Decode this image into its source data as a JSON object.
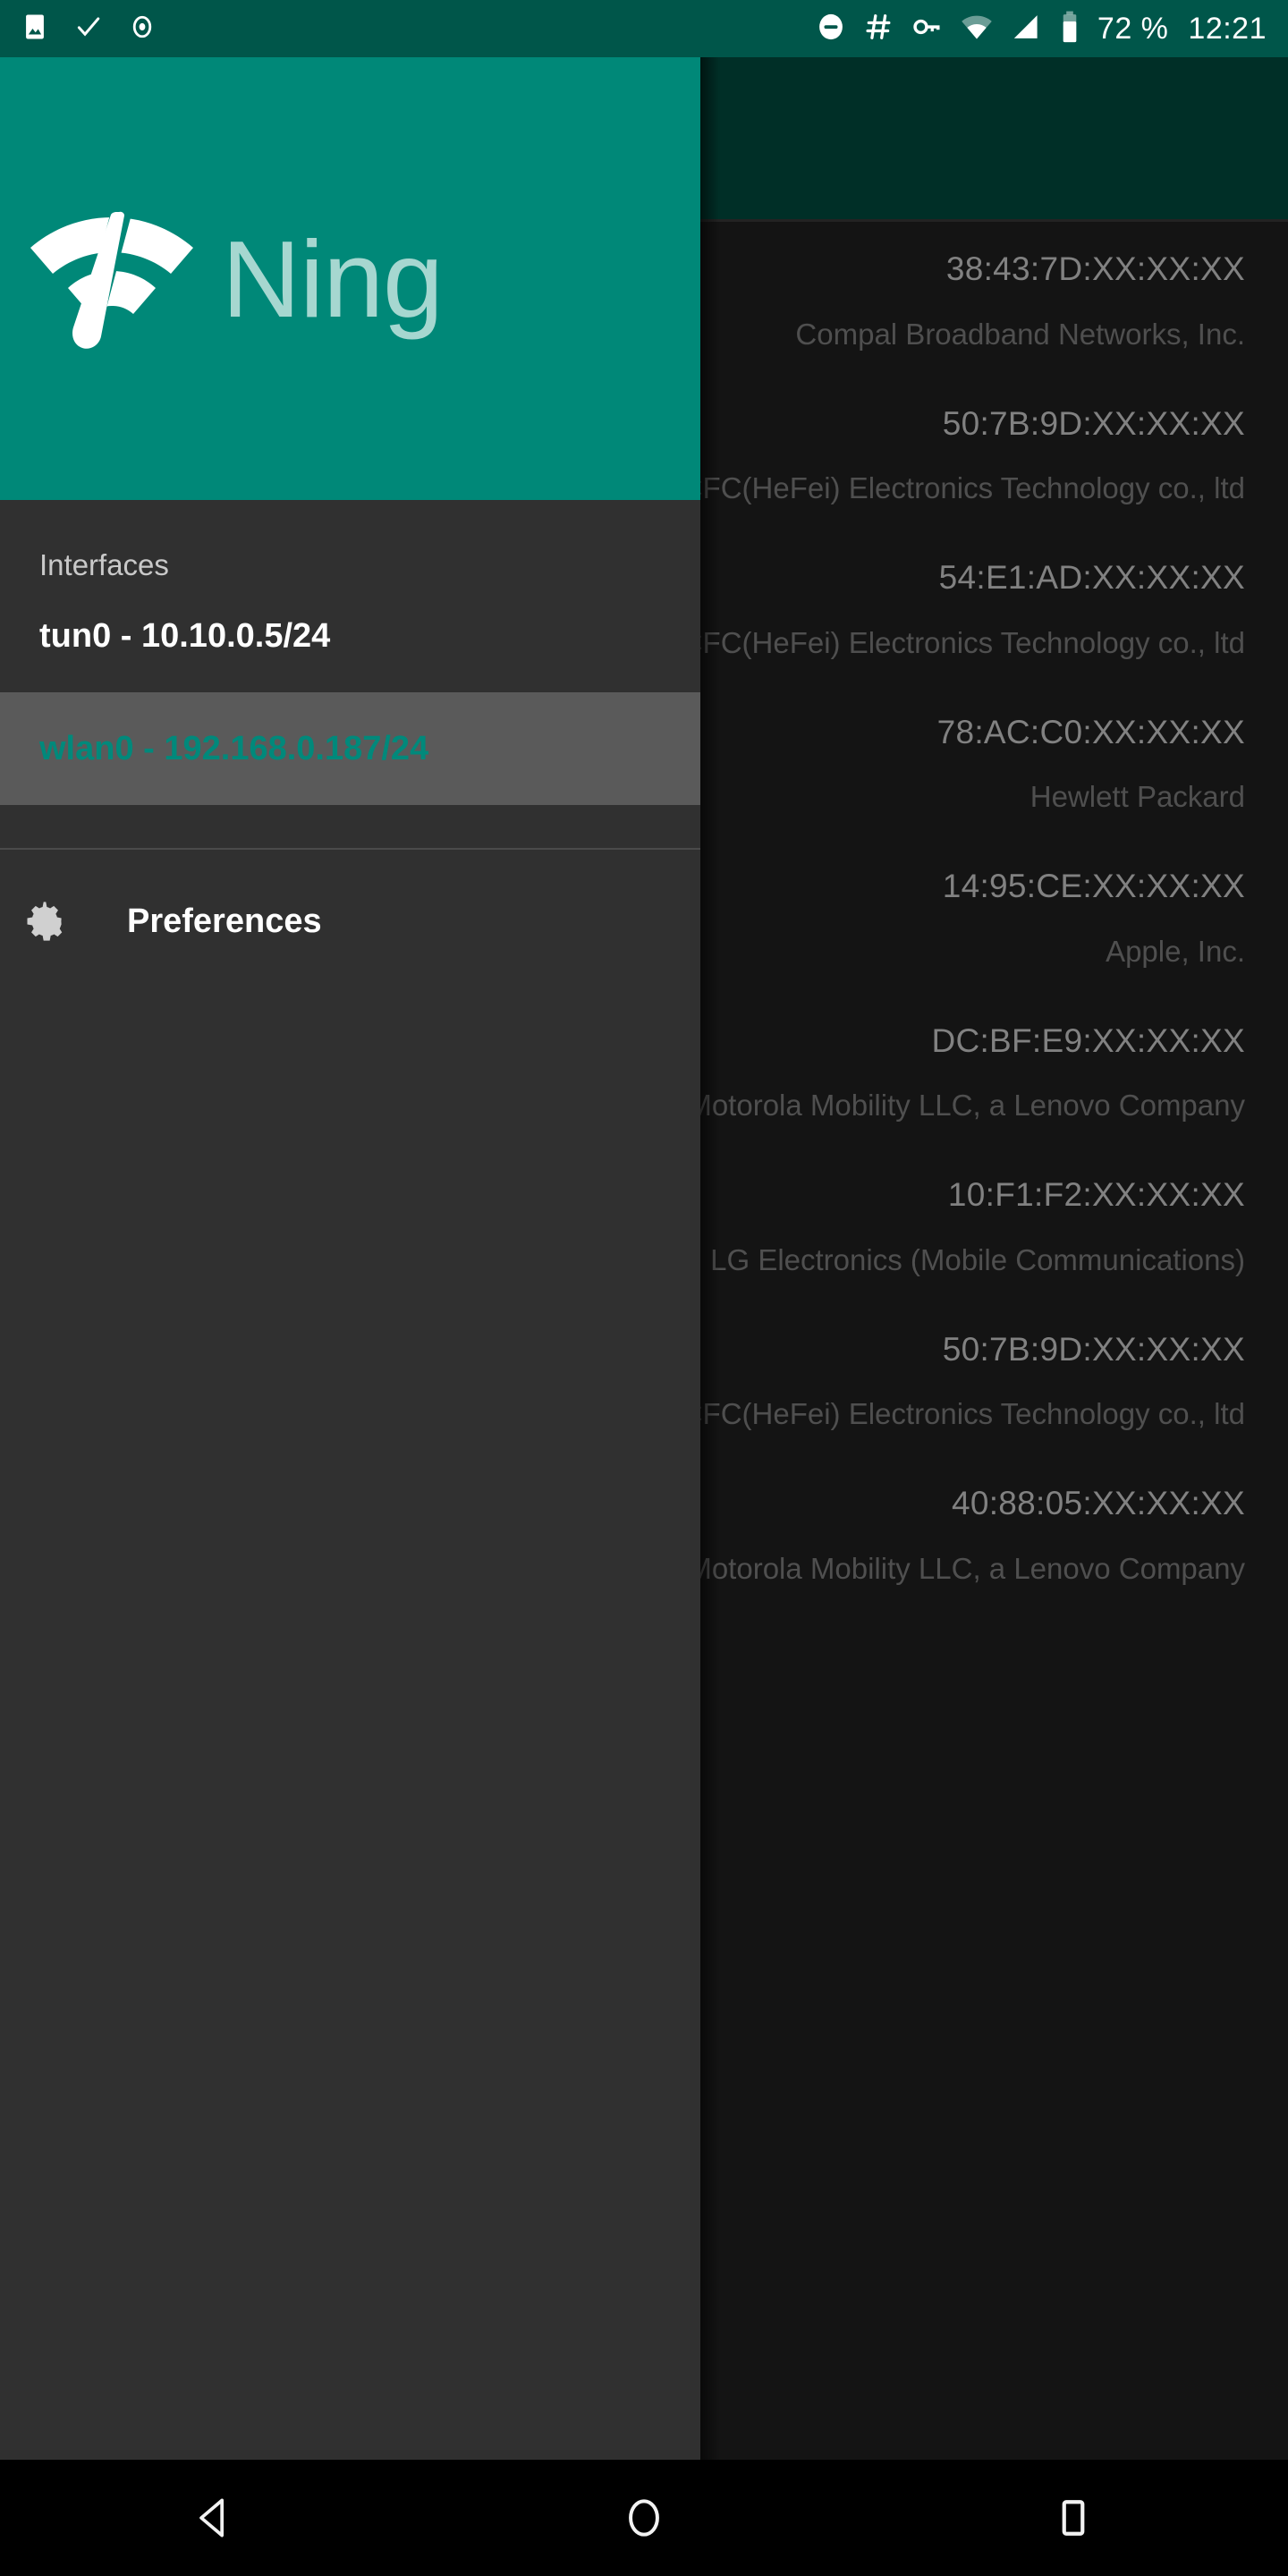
{
  "status_bar": {
    "background_color": "#00564A",
    "left_icons": [
      {
        "name": "image-icon",
        "glyph": "picture"
      },
      {
        "name": "check-icon",
        "glyph": "check"
      },
      {
        "name": "record-icon",
        "glyph": "record"
      }
    ],
    "right_icons": [
      {
        "name": "do-not-disturb-icon",
        "glyph": "minus-circle"
      },
      {
        "name": "hash-icon",
        "glyph": "hash"
      },
      {
        "name": "vpn-key-icon",
        "glyph": "key"
      },
      {
        "name": "wifi-icon",
        "glyph": "wifi"
      },
      {
        "name": "cellular-signal-icon",
        "glyph": "signal"
      },
      {
        "name": "battery-icon",
        "glyph": "battery"
      }
    ],
    "battery_text": "72 %",
    "clock": "12:21"
  },
  "drawer": {
    "background_color": "#303030",
    "header": {
      "background_color": "#008878",
      "brand_name": "Ning",
      "brand_name_color": "#a6d7d0",
      "logo_name": "wifi-speedometer-logo"
    },
    "section_title": "Interfaces",
    "interfaces": [
      {
        "label": "tun0 - 10.10.0.5/24",
        "selected": false
      },
      {
        "label": "wlan0 - 192.168.0.187/24",
        "selected": true
      }
    ],
    "selected_item_background": "#5a5a5a",
    "selected_item_color": "#00897B",
    "preferences": {
      "label": "Preferences",
      "icon_name": "gear-icon"
    }
  },
  "content": {
    "toolbar_color": "#00382F",
    "background_color": "#181818",
    "devices": [
      {
        "mac": "38:43:7D:XX:XX:XX",
        "vendor": "Compal Broadband Networks, Inc."
      },
      {
        "mac": "50:7B:9D:XX:XX:XX",
        "vendor": "LCFC(HeFei) Electronics Technology co., ltd"
      },
      {
        "mac": "54:E1:AD:XX:XX:XX",
        "vendor": "LCFC(HeFei) Electronics Technology co., ltd"
      },
      {
        "mac": "78:AC:C0:XX:XX:XX",
        "vendor": "Hewlett Packard"
      },
      {
        "mac": "14:95:CE:XX:XX:XX",
        "vendor": "Apple, Inc."
      },
      {
        "mac": "DC:BF:E9:XX:XX:XX",
        "vendor": "Motorola Mobility LLC, a Lenovo Company"
      },
      {
        "mac": "10:F1:F2:XX:XX:XX",
        "vendor": "LG Electronics (Mobile Communications)"
      },
      {
        "mac": "50:7B:9D:XX:XX:XX",
        "vendor": "LCFC(HeFei) Electronics Technology co., ltd"
      },
      {
        "mac": "40:88:05:XX:XX:XX",
        "vendor": "Motorola Mobility LLC, a Lenovo Company"
      }
    ]
  },
  "nav_bar": {
    "background_color": "#000000",
    "buttons": [
      {
        "name": "back-button",
        "glyph": "triangle-left"
      },
      {
        "name": "home-button",
        "glyph": "circle"
      },
      {
        "name": "recents-button",
        "glyph": "square"
      }
    ]
  }
}
